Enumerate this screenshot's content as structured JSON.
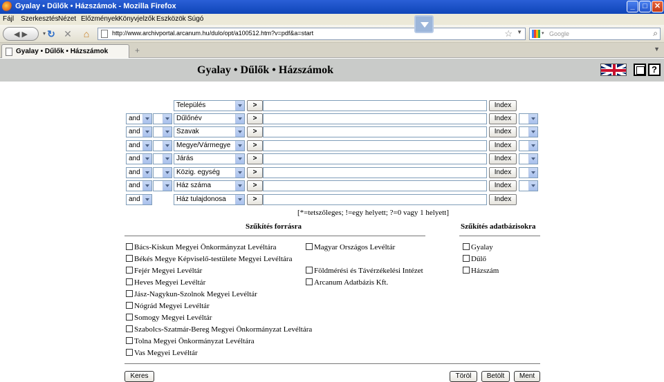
{
  "window": {
    "title": "Gyalay • Dűlők • Házszámok - Mozilla Firefox"
  },
  "menu": [
    "Fájl",
    "Szerkesztés",
    "Nézet",
    "Előzmények",
    "Könyvjelzők",
    "Eszközök",
    "Súgó"
  ],
  "toolbar": {
    "url": "http://www.archivportal.arcanum.hu/dulo/opt/a100512.htm?v=pdf&a=start",
    "search_engine": "google-icon",
    "search_placeholder": "Google"
  },
  "tab": {
    "title": "Gyalay • Dűlők • Házszámok",
    "new_tab": "+"
  },
  "page": {
    "title": "Gyalay • Dűlők • Házszámok",
    "help_label": "?"
  },
  "rows": [
    {
      "operator": "",
      "field": "Település",
      "go": ">",
      "index": "Index"
    },
    {
      "operator": "and",
      "field": "Dűlőnév",
      "go": ">",
      "index": "Index"
    },
    {
      "operator": "and",
      "field": "Szavak",
      "go": ">",
      "index": "Index"
    },
    {
      "operator": "and",
      "field": "Megye/Vármegye",
      "go": ">",
      "index": "Index"
    },
    {
      "operator": "and",
      "field": "Járás",
      "go": ">",
      "index": "Index"
    },
    {
      "operator": "and",
      "field": "Közig. egység",
      "go": ">",
      "index": "Index"
    },
    {
      "operator": "and",
      "field": "Ház száma",
      "go": ">",
      "index": "Index"
    },
    {
      "operator": "and",
      "field": "Ház tulajdonosa",
      "go": ">",
      "index": "Index"
    }
  ],
  "wildcard_note": "[*=tetszőleges; !=egy helyett; ?=0 vagy 1 helyett]",
  "sources": {
    "heading": "Szűkítés forrásra",
    "col1": [
      "Bács-Kiskun Megyei Önkormányzat Levéltára",
      "Békés Megye Képviselő-testülete Megyei Levéltára",
      "Fejér Megyei Levéltár",
      "Heves Megyei Levéltár",
      "Jász-Nagykun-Szolnok Megyei Levéltár",
      "Nógrád Megyei Levéltár",
      "Somogy Megyei Levéltár",
      "Szabolcs-Szatmár-Bereg Megyei Önkormányzat Levéltára",
      "Tolna Megyei Önkormányzat Levéltára",
      "Vas Megyei Levéltár"
    ],
    "col2": [
      "Magyar Országos Levéltár",
      "Földmérési és Távérzékelési Intézet",
      "Arcanum Adatbázis Kft."
    ]
  },
  "databases": {
    "heading": "Szűkítés adatbázisokra",
    "items": [
      "Gyalay",
      "Dűlő",
      "Házszám"
    ]
  },
  "buttons": {
    "search": "Keres",
    "clear": "Töröl",
    "load": "Betölt",
    "save": "Ment"
  }
}
